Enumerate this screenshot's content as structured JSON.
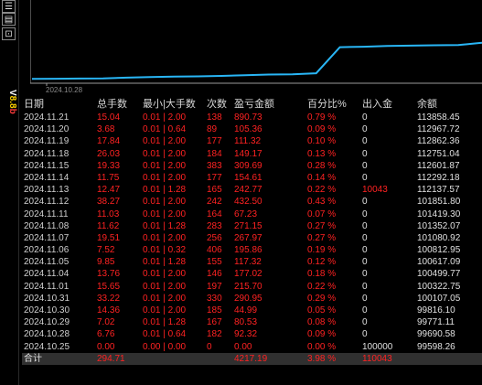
{
  "toolbar": {
    "buttons": [
      {
        "glyph": "☰"
      },
      {
        "glyph": "▤"
      },
      {
        "glyph": "⊡"
      }
    ],
    "vertical_label": {
      "part1": "V",
      "part2": "8.8",
      "part3": "b"
    }
  },
  "chart": {
    "axis_date": "2024.10.28",
    "line_color": "#29b6f6",
    "points": [
      [
        "2024.10.25",
        99598.26
      ],
      [
        "2024.10.28",
        99690.58
      ],
      [
        "2024.10.29",
        99771.11
      ],
      [
        "2024.10.30",
        99816.1
      ],
      [
        "2024.10.31",
        100107.05
      ],
      [
        "2024.11.01",
        100322.75
      ],
      [
        "2024.11.04",
        100499.77
      ],
      [
        "2024.11.05",
        100617.09
      ],
      [
        "2024.11.06",
        100812.95
      ],
      [
        "2024.11.07",
        101080.92
      ],
      [
        "2024.11.08",
        101352.07
      ],
      [
        "2024.11.11",
        101419.3
      ],
      [
        "2024.11.12",
        101851.8
      ],
      [
        "2024.11.13",
        112137.57
      ],
      [
        "2024.11.14",
        112292.18
      ],
      [
        "2024.11.15",
        112601.87
      ],
      [
        "2024.11.18",
        112751.04
      ],
      [
        "2024.11.19",
        112862.36
      ],
      [
        "2024.11.20",
        112967.72
      ],
      [
        "2024.11.21",
        113858.45
      ]
    ]
  },
  "table": {
    "headers": [
      "日期",
      "总手数",
      "最小|大手数",
      "次数",
      "盈亏金额",
      "百分比%",
      "出入金",
      "余额"
    ],
    "rows": [
      [
        "2024.11.21",
        "15.04",
        "0.01 | 2.00",
        "138",
        "890.73",
        "0.79 %",
        "0",
        "113858.45"
      ],
      [
        "2024.11.20",
        "3.68",
        "0.01 | 0.64",
        "89",
        "105.36",
        "0.09 %",
        "0",
        "112967.72"
      ],
      [
        "2024.11.19",
        "17.84",
        "0.01 | 2.00",
        "177",
        "111.32",
        "0.10 %",
        "0",
        "112862.36"
      ],
      [
        "2024.11.18",
        "26.03",
        "0.01 | 2.00",
        "184",
        "149.17",
        "0.13 %",
        "0",
        "112751.04"
      ],
      [
        "2024.11.15",
        "19.33",
        "0.01 | 2.00",
        "383",
        "309.69",
        "0.28 %",
        "0",
        "112601.87"
      ],
      [
        "2024.11.14",
        "11.75",
        "0.01 | 2.00",
        "177",
        "154.61",
        "0.14 %",
        "0",
        "112292.18"
      ],
      [
        "2024.11.13",
        "12.47",
        "0.01 | 1.28",
        "165",
        "242.77",
        "0.22 %",
        "10043",
        "112137.57"
      ],
      [
        "2024.11.12",
        "38.27",
        "0.01 | 2.00",
        "242",
        "432.50",
        "0.43 %",
        "0",
        "101851.80"
      ],
      [
        "2024.11.11",
        "11.03",
        "0.01 | 2.00",
        "164",
        "67.23",
        "0.07 %",
        "0",
        "101419.30"
      ],
      [
        "2024.11.08",
        "11.62",
        "0.01 | 1.28",
        "283",
        "271.15",
        "0.27 %",
        "0",
        "101352.07"
      ],
      [
        "2024.11.07",
        "19.51",
        "0.01 | 2.00",
        "256",
        "267.97",
        "0.27 %",
        "0",
        "101080.92"
      ],
      [
        "2024.11.06",
        "7.52",
        "0.01 | 0.32",
        "406",
        "195.86",
        "0.19 %",
        "0",
        "100812.95"
      ],
      [
        "2024.11.05",
        "9.85",
        "0.01 | 1.28",
        "155",
        "117.32",
        "0.12 %",
        "0",
        "100617.09"
      ],
      [
        "2024.11.04",
        "13.76",
        "0.01 | 2.00",
        "146",
        "177.02",
        "0.18 %",
        "0",
        "100499.77"
      ],
      [
        "2024.11.01",
        "15.65",
        "0.01 | 2.00",
        "197",
        "215.70",
        "0.22 %",
        "0",
        "100322.75"
      ],
      [
        "2024.10.31",
        "33.22",
        "0.01 | 2.00",
        "330",
        "290.95",
        "0.29 %",
        "0",
        "100107.05"
      ],
      [
        "2024.10.30",
        "14.36",
        "0.01 | 2.00",
        "185",
        "44.99",
        "0.05 %",
        "0",
        "99816.10"
      ],
      [
        "2024.10.29",
        "7.02",
        "0.01 | 1.28",
        "167",
        "80.53",
        "0.08 %",
        "0",
        "99771.11"
      ],
      [
        "2024.10.28",
        "6.76",
        "0.01 | 0.64",
        "182",
        "92.32",
        "0.09 %",
        "0",
        "99690.58"
      ],
      [
        "2024.10.25",
        "0.00",
        "0.00 | 0.00",
        "0",
        "0.00",
        "0.00 %",
        "100000",
        "99598.26"
      ]
    ],
    "total": {
      "label": "合计",
      "lots": "294.71",
      "profit": "4217.19",
      "pct": "3.98 %",
      "flow": "110043"
    }
  },
  "colors": {
    "positive": "#ff2222",
    "neutral": "#e0e0e0",
    "background": "#000000"
  }
}
